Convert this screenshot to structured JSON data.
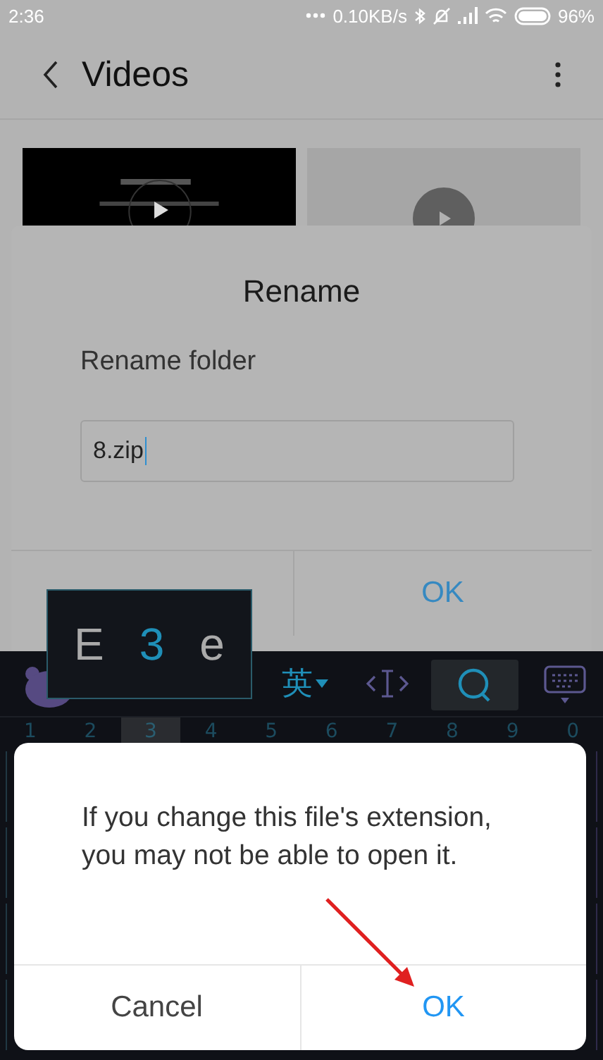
{
  "status_bar": {
    "time": "2:36",
    "speed": "0.10KB/s",
    "battery": "96%"
  },
  "header": {
    "title": "Videos"
  },
  "thumbnails": [
    {
      "kind": "picture"
    },
    {
      "kind": "placeholder"
    }
  ],
  "rename_dialog": {
    "title": "Rename",
    "label": "Rename folder",
    "value": "8.zip",
    "ok": "OK"
  },
  "keyboard": {
    "popup": [
      {
        "label": "E",
        "selected": false
      },
      {
        "label": "3",
        "selected": true
      },
      {
        "label": "e",
        "selected": false
      }
    ],
    "language": "英",
    "numbers": [
      {
        "label": "1",
        "selected": false
      },
      {
        "label": "2",
        "selected": false
      },
      {
        "label": "3",
        "selected": true
      },
      {
        "label": "4",
        "selected": false
      },
      {
        "label": "5",
        "selected": false
      },
      {
        "label": "6",
        "selected": false
      },
      {
        "label": "7",
        "selected": false
      },
      {
        "label": "8",
        "selected": false
      },
      {
        "label": "9",
        "selected": false
      },
      {
        "label": "0",
        "selected": false
      }
    ]
  },
  "alert": {
    "message": "If you change this file's extension, you may not be able to open it.",
    "buttons": [
      "Cancel",
      "OK"
    ]
  }
}
